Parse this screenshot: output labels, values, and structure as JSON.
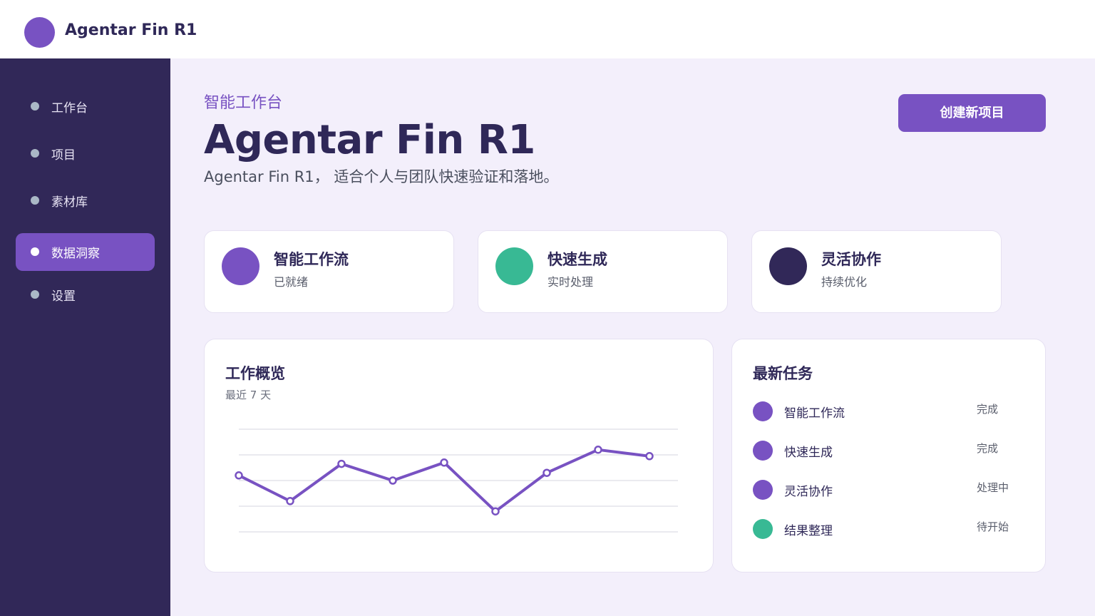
{
  "app": {
    "title": "Agentar Fin R1"
  },
  "colors": {
    "accent": "#7852c2",
    "green": "#38b994",
    "navy": "#312858",
    "sidebar": "#312858"
  },
  "sidebar": {
    "items": [
      {
        "label": "工作台",
        "active": false
      },
      {
        "label": "项目",
        "active": false
      },
      {
        "label": "素材库",
        "active": false
      },
      {
        "label": "数据洞察",
        "active": true
      },
      {
        "label": "设置",
        "active": false
      }
    ]
  },
  "header": {
    "eyebrow": "智能工作台",
    "title": "Agentar Fin R1",
    "description": "Agentar Fin R1， 适合个人与团队快速验证和落地。",
    "create_button": "创建新项目"
  },
  "features": [
    {
      "title": "智能工作流",
      "subtitle": "已就绪",
      "color": "#7852c2"
    },
    {
      "title": "快速生成",
      "subtitle": "实时处理",
      "color": "#38b994"
    },
    {
      "title": "灵活协作",
      "subtitle": "持续优化",
      "color": "#312858"
    }
  ],
  "overview": {
    "title": "工作概览",
    "subtitle": "最近 7 天"
  },
  "chart_data": {
    "type": "line",
    "title": "工作概览",
    "subtitle": "最近 7 天",
    "xlabel": "",
    "ylabel": "",
    "grid": true,
    "ylim": [
      0,
      4
    ],
    "series": [
      {
        "values": [
          2.2,
          1.2,
          2.65,
          2.0,
          2.7,
          0.8,
          2.3,
          3.2,
          2.95
        ]
      }
    ]
  },
  "tasks": {
    "title": "最新任务",
    "items": [
      {
        "name": "智能工作流",
        "status": "完成",
        "color": "#7852c2"
      },
      {
        "name": "快速生成",
        "status": "完成",
        "color": "#7852c2"
      },
      {
        "name": "灵活协作",
        "status": "处理中",
        "color": "#7852c2"
      },
      {
        "name": "结果整理",
        "status": "待开始",
        "color": "#38b994"
      }
    ]
  }
}
